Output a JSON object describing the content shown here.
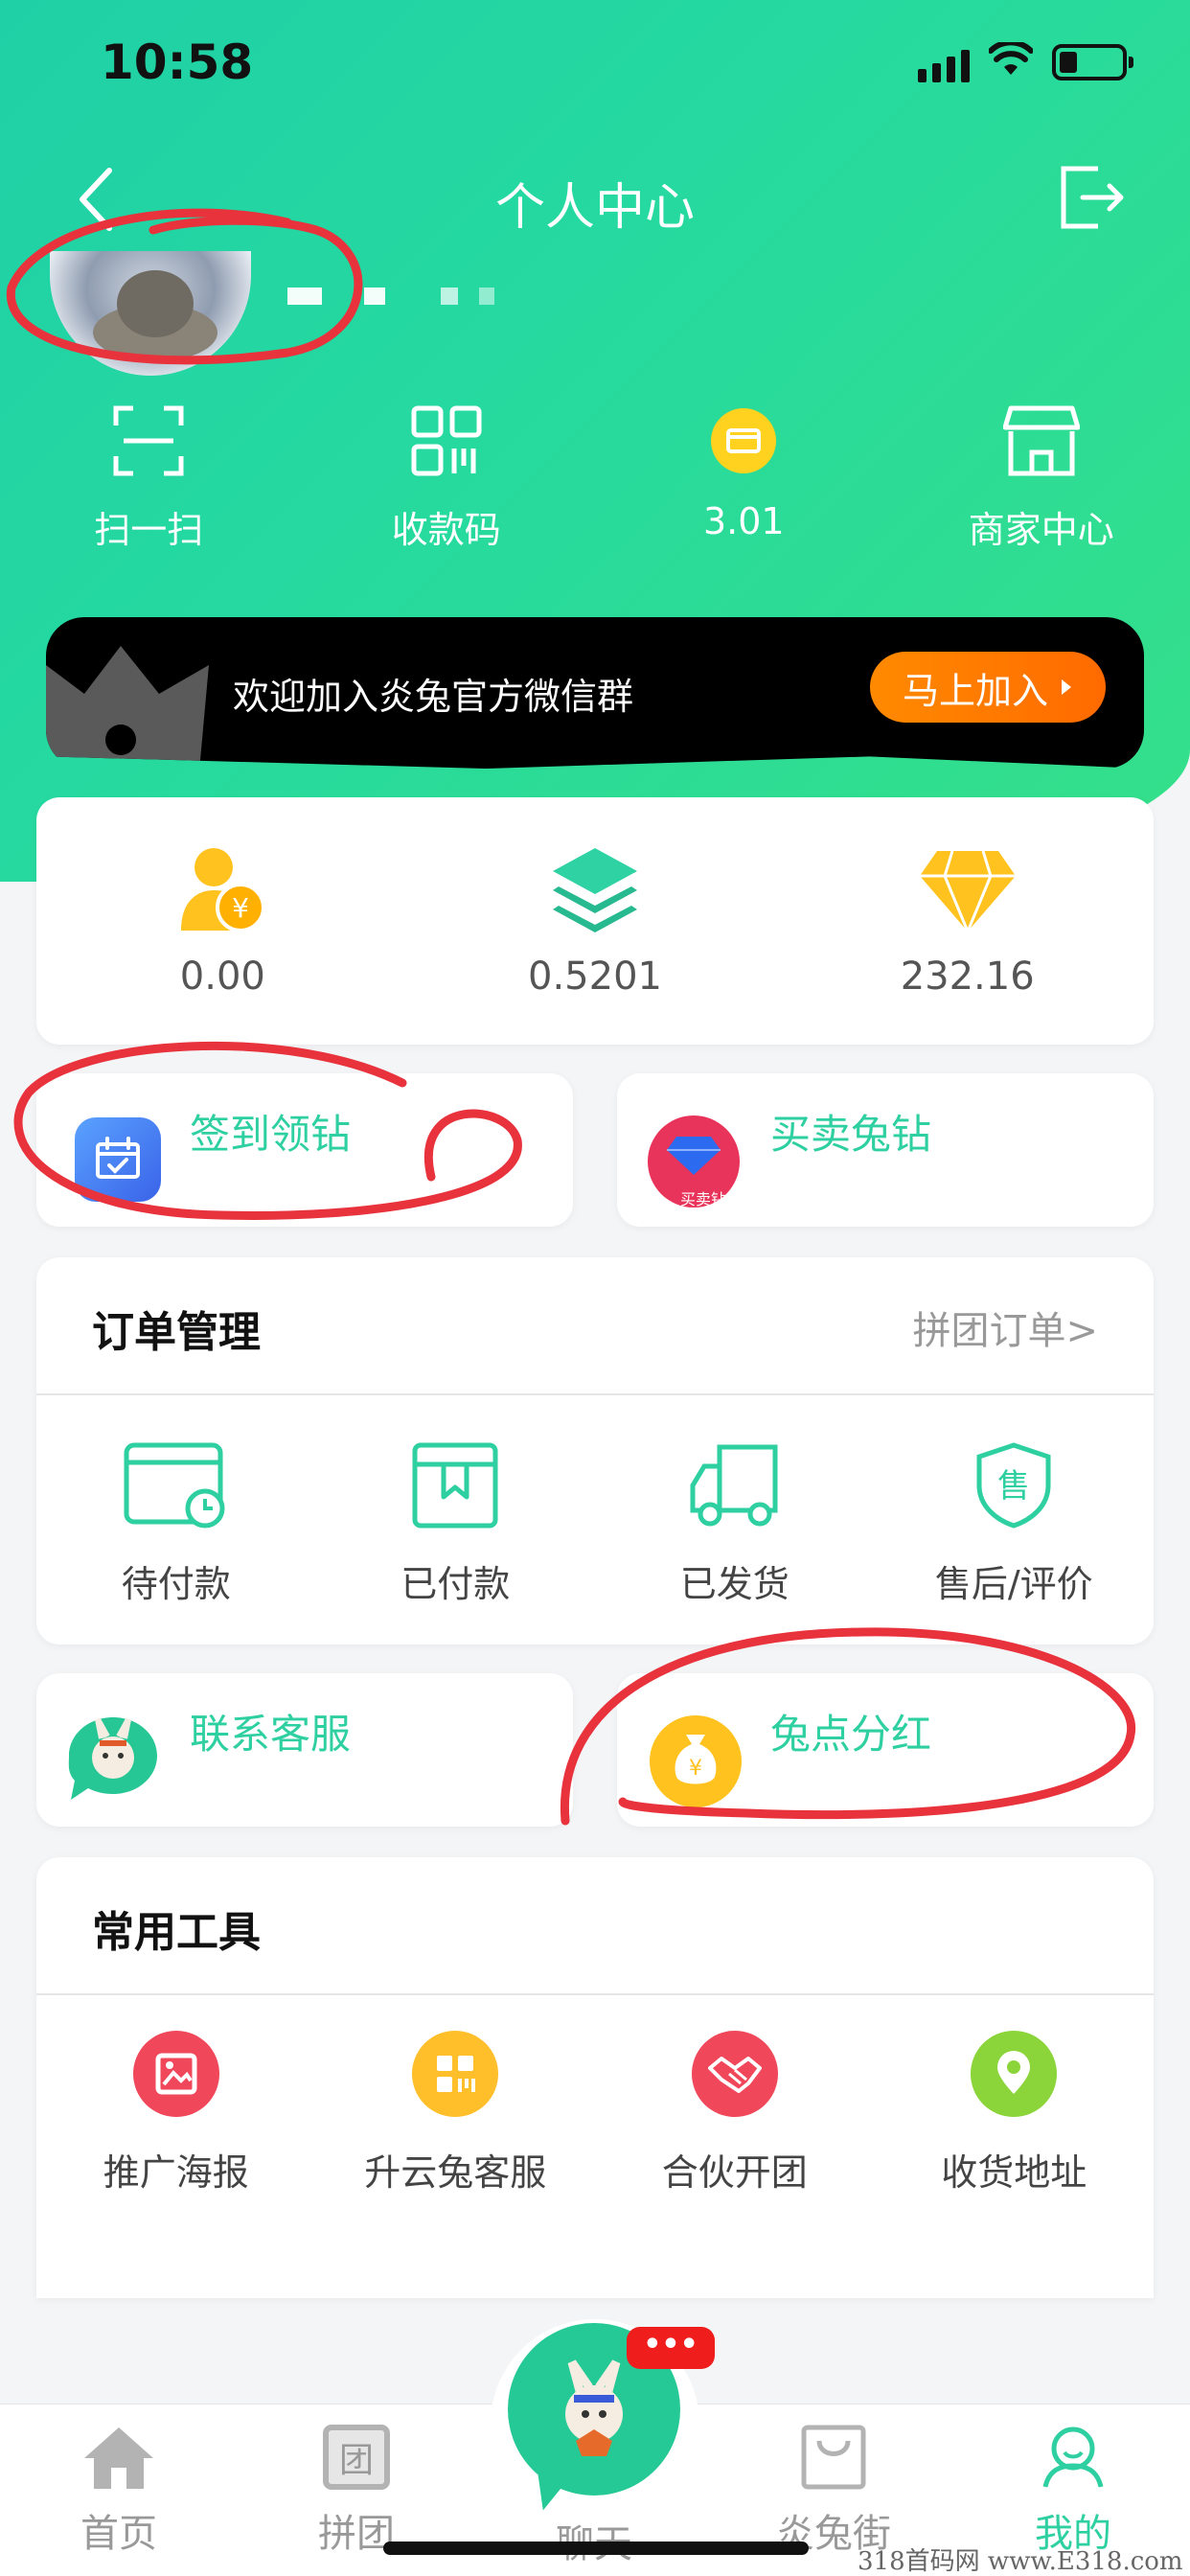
{
  "status_bar": {
    "time": "10:58"
  },
  "header": {
    "title": "个人中心"
  },
  "quick_actions": [
    {
      "label": "扫一扫",
      "icon": "scan-icon"
    },
    {
      "label": "收款码",
      "icon": "qr-code-icon"
    },
    {
      "label": "3.01",
      "icon": "wallet-coin-icon"
    },
    {
      "label": "商家中心",
      "icon": "store-icon"
    }
  ],
  "banner": {
    "text": "欢迎加入炎兔官方微信群",
    "button": "马上加入"
  },
  "assets": [
    {
      "value": "0.00",
      "icon": "user-yuan-icon"
    },
    {
      "value": "0.5201",
      "icon": "layers-icon"
    },
    {
      "value": "232.16",
      "icon": "diamond-icon"
    }
  ],
  "signin": {
    "label": "签到领钻",
    "icon": "calendar-check-icon"
  },
  "trade": {
    "label": "买卖兔钻",
    "icon": "buy-sell-diamond-icon",
    "icon_caption": "买卖钻"
  },
  "orders": {
    "title": "订单管理",
    "more": "拼团订单>",
    "items": [
      {
        "label": "待付款",
        "icon": "pending-payment-icon"
      },
      {
        "label": "已付款",
        "icon": "paid-icon"
      },
      {
        "label": "已发货",
        "icon": "shipped-truck-icon"
      },
      {
        "label": "售后/评价",
        "icon": "after-sales-icon"
      }
    ]
  },
  "service": {
    "label": "联系客服",
    "icon": "customer-service-icon"
  },
  "dividend": {
    "label": "兔点分红",
    "icon": "money-bag-icon"
  },
  "tools": {
    "title": "常用工具",
    "items": [
      {
        "label": "推广海报",
        "icon": "poster-icon",
        "color": "#f0475a"
      },
      {
        "label": "升云兔客服",
        "icon": "grid-service-icon",
        "color": "#ffbf2a"
      },
      {
        "label": "合伙开团",
        "icon": "handshake-icon",
        "color": "#f0475a"
      },
      {
        "label": "收货地址",
        "icon": "location-icon",
        "color": "#8bd43a"
      }
    ]
  },
  "tabbar": {
    "items": [
      {
        "label": "首页",
        "icon": "home-icon"
      },
      {
        "label": "拼团",
        "icon": "group-icon"
      },
      {
        "label": "聊天",
        "icon": "chat-icon"
      },
      {
        "label": "炎兔街",
        "icon": "shopping-bag-icon"
      },
      {
        "label": "我的",
        "icon": "profile-icon"
      }
    ],
    "chat_badge": "•••"
  },
  "watermark": "318首码网 www.E318.com",
  "colors": {
    "accent": "#2ecfa0",
    "orange": "#ff7a00",
    "annotation": "#e8323c"
  }
}
